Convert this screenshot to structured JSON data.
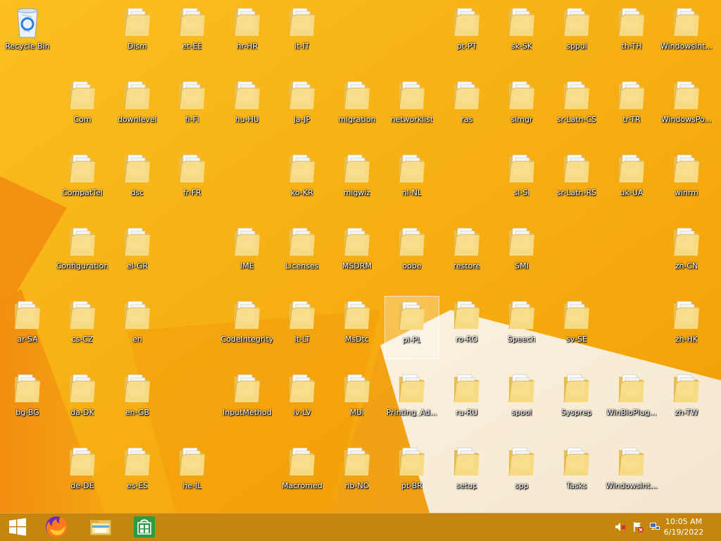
{
  "desktop": {
    "icons": [
      {
        "label": "Recycle Bin",
        "type": "recycle"
      },
      {
        "label": "Dism",
        "type": "folder"
      },
      {
        "label": "et-EE",
        "type": "folder"
      },
      {
        "label": "hr-HR",
        "type": "folder"
      },
      {
        "label": "it-IT",
        "type": "folder"
      },
      {
        "label": "pt-PT",
        "type": "folder"
      },
      {
        "label": "sk-SK",
        "type": "folder"
      },
      {
        "label": "sppui",
        "type": "folder"
      },
      {
        "label": "th-TH",
        "type": "folder"
      },
      {
        "label": "WindowsInt...",
        "type": "folder"
      },
      {
        "label": "Com",
        "type": "folder"
      },
      {
        "label": "downlevel",
        "type": "folder"
      },
      {
        "label": "fi-FI",
        "type": "folder"
      },
      {
        "label": "hu-HU",
        "type": "folder"
      },
      {
        "label": "ja-JP",
        "type": "folder"
      },
      {
        "label": "migration",
        "type": "folder"
      },
      {
        "label": "networklist",
        "type": "folder"
      },
      {
        "label": "ras",
        "type": "folder"
      },
      {
        "label": "slmgr",
        "type": "folder"
      },
      {
        "label": "sr-Latn-CS",
        "type": "folder"
      },
      {
        "label": "tr-TR",
        "type": "folder"
      },
      {
        "label": "WindowsPo...",
        "type": "folder"
      },
      {
        "label": "CompatTel",
        "type": "folder"
      },
      {
        "label": "dsc",
        "type": "folder"
      },
      {
        "label": "fr-FR",
        "type": "folder"
      },
      {
        "label": "ko-KR",
        "type": "folder"
      },
      {
        "label": "migwiz",
        "type": "folder"
      },
      {
        "label": "nl-NL",
        "type": "folder"
      },
      {
        "label": "sl-SI",
        "type": "folder"
      },
      {
        "label": "sr-Latn-RS",
        "type": "folder"
      },
      {
        "label": "uk-UA",
        "type": "folder"
      },
      {
        "label": "winrm",
        "type": "folder"
      },
      {
        "label": "Configuration",
        "type": "folder"
      },
      {
        "label": "el-GR",
        "type": "folder"
      },
      {
        "label": "IME",
        "type": "folder"
      },
      {
        "label": "Licenses",
        "type": "folder"
      },
      {
        "label": "MSDRM",
        "type": "folder"
      },
      {
        "label": "oobe",
        "type": "folder"
      },
      {
        "label": "restore",
        "type": "folder"
      },
      {
        "label": "SMI",
        "type": "folder"
      },
      {
        "label": "zh-CN",
        "type": "folder"
      },
      {
        "label": "ar-SA",
        "type": "folder"
      },
      {
        "label": "cs-CZ",
        "type": "folder"
      },
      {
        "label": "en",
        "type": "folder"
      },
      {
        "label": "CodeIntegrity",
        "type": "folder"
      },
      {
        "label": "lt-LT",
        "type": "folder"
      },
      {
        "label": "MsDtc",
        "type": "folder"
      },
      {
        "label": "pl-PL",
        "type": "folder",
        "selected": true
      },
      {
        "label": "ro-RO",
        "type": "folder"
      },
      {
        "label": "Speech",
        "type": "folder"
      },
      {
        "label": "sv-SE",
        "type": "folder"
      },
      {
        "label": "zh-HK",
        "type": "folder"
      },
      {
        "label": "bg-BG",
        "type": "folder"
      },
      {
        "label": "da-DK",
        "type": "folder"
      },
      {
        "label": "en-GB",
        "type": "folder"
      },
      {
        "label": "InputMethod",
        "type": "folder"
      },
      {
        "label": "lv-LV",
        "type": "folder"
      },
      {
        "label": "MUI",
        "type": "folder"
      },
      {
        "label": "Printing_Ad...",
        "type": "folder"
      },
      {
        "label": "ru-RU",
        "type": "folder"
      },
      {
        "label": "spool",
        "type": "folder"
      },
      {
        "label": "Sysprep",
        "type": "folder"
      },
      {
        "label": "WinBioPlug...",
        "type": "folder"
      },
      {
        "label": "zh-TW",
        "type": "folder"
      },
      {
        "label": "de-DE",
        "type": "folder"
      },
      {
        "label": "es-ES",
        "type": "folder"
      },
      {
        "label": "he-IL",
        "type": "folder"
      },
      {
        "label": "Macromed",
        "type": "folder"
      },
      {
        "label": "nb-NO",
        "type": "folder"
      },
      {
        "label": "pt-BR",
        "type": "folder"
      },
      {
        "label": "setup",
        "type": "folder"
      },
      {
        "label": "spp",
        "type": "folder"
      },
      {
        "label": "Tasks",
        "type": "folder"
      },
      {
        "label": "WindowsInt...",
        "type": "folder"
      }
    ]
  },
  "taskbar": {
    "buttons": [
      {
        "name": "start-button",
        "icon": "windows-logo-icon"
      },
      {
        "name": "firefox-button",
        "icon": "firefox-icon"
      },
      {
        "name": "file-explorer-button",
        "icon": "file-explorer-icon"
      },
      {
        "name": "store-button",
        "icon": "store-icon"
      }
    ],
    "tray": [
      {
        "name": "volume-muted-icon"
      },
      {
        "name": "action-center-flag-icon"
      },
      {
        "name": "network-icon"
      }
    ],
    "clock": {
      "time": "10:05 AM",
      "date": "6/19/2022"
    }
  },
  "colors": {
    "wallpaper": "#f7ae0a",
    "taskbar": "#c5860f",
    "folder": "#f5d77a"
  }
}
